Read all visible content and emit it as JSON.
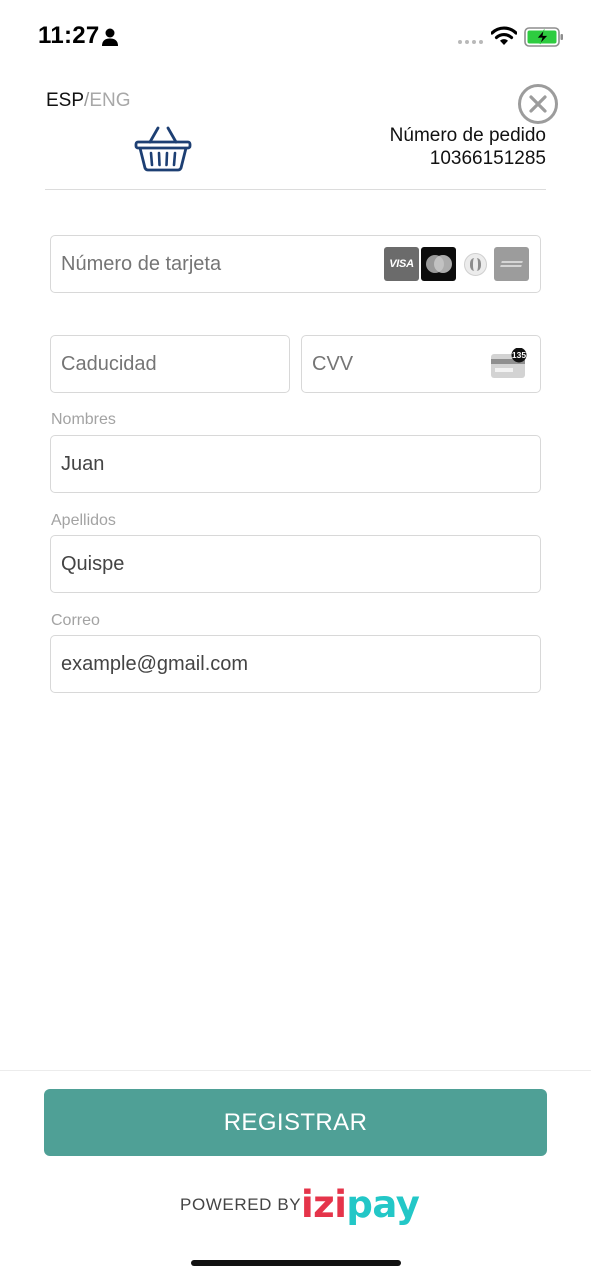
{
  "status_bar": {
    "time": "11:27",
    "icons": [
      "person-icon",
      "signal-dots-icon",
      "wifi-icon",
      "battery-charging-icon"
    ],
    "battery_color": "#2ecc40"
  },
  "header": {
    "lang_esp": "ESP",
    "lang_sep": "/",
    "lang_eng": "ENG",
    "order_label": "Número de pedido",
    "order_number": "10366151285",
    "basket_color": "#1d3f73"
  },
  "form": {
    "card_number": {
      "placeholder": "Número de tarjeta",
      "logos": [
        "VISA",
        "mastercard-icon",
        "diners-icon",
        "amex-icon"
      ]
    },
    "expiry": {
      "placeholder": "Caducidad"
    },
    "cvv": {
      "placeholder": "CVV",
      "icon_badge": "135"
    },
    "first_name": {
      "label": "Nombres",
      "value": "Juan"
    },
    "last_name": {
      "label": "Apellidos",
      "value": "Quispe"
    },
    "email": {
      "label": "Correo",
      "value": "example@gmail.com"
    }
  },
  "actions": {
    "register_label": "REGISTRAR",
    "register_color": "#4fa096"
  },
  "footer": {
    "powered_by": "POWERED BY",
    "brand_izi": "izi",
    "brand_pay": "pay",
    "brand_colors": {
      "izi": "#e5344a",
      "pay": "#23c7c7"
    }
  }
}
